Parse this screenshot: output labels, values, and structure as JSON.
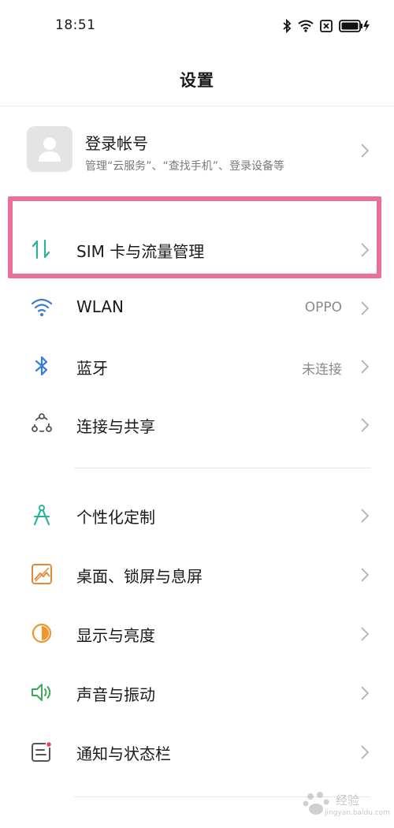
{
  "status_bar": {
    "time": "18:51",
    "icons": [
      "bluetooth-icon",
      "wifi-icon",
      "sim-off-icon",
      "battery-charging-icon"
    ]
  },
  "header": {
    "title": "设置"
  },
  "account": {
    "title": "登录帐号",
    "subtitle": "管理“云服务”、“查找手机”、登录设备等",
    "icon": "user-avatar-icon"
  },
  "rows": [
    {
      "label": "SIM 卡与流量管理",
      "value": "",
      "icon": "sim-data-icon",
      "color": "#2bb39a"
    },
    {
      "label": "WLAN",
      "value": "OPPO",
      "icon": "wifi-icon",
      "color": "#3a7bd5"
    },
    {
      "label": "蓝牙",
      "value": "未连接",
      "icon": "bluetooth-icon",
      "color": "#3a7bd5"
    },
    {
      "label": "连接与共享",
      "value": "",
      "icon": "share-icon",
      "color": "#555555"
    },
    {
      "label": "个性化定制",
      "value": "",
      "icon": "compass-icon",
      "color": "#2bb39a"
    },
    {
      "label": "桌面、锁屏与息屏",
      "value": "",
      "icon": "wallpaper-icon",
      "color": "#e38a3a"
    },
    {
      "label": "显示与亮度",
      "value": "",
      "icon": "brightness-icon",
      "color": "#f0962e"
    },
    {
      "label": "声音与振动",
      "value": "",
      "icon": "speaker-icon",
      "color": "#3aa856"
    },
    {
      "label": "通知与状态栏",
      "value": "",
      "icon": "notification-icon",
      "color": "#555555"
    }
  ],
  "highlight_color": "#ea6f9c",
  "watermark": {
    "text": "经验",
    "url": "jingyan.baidu.com"
  }
}
